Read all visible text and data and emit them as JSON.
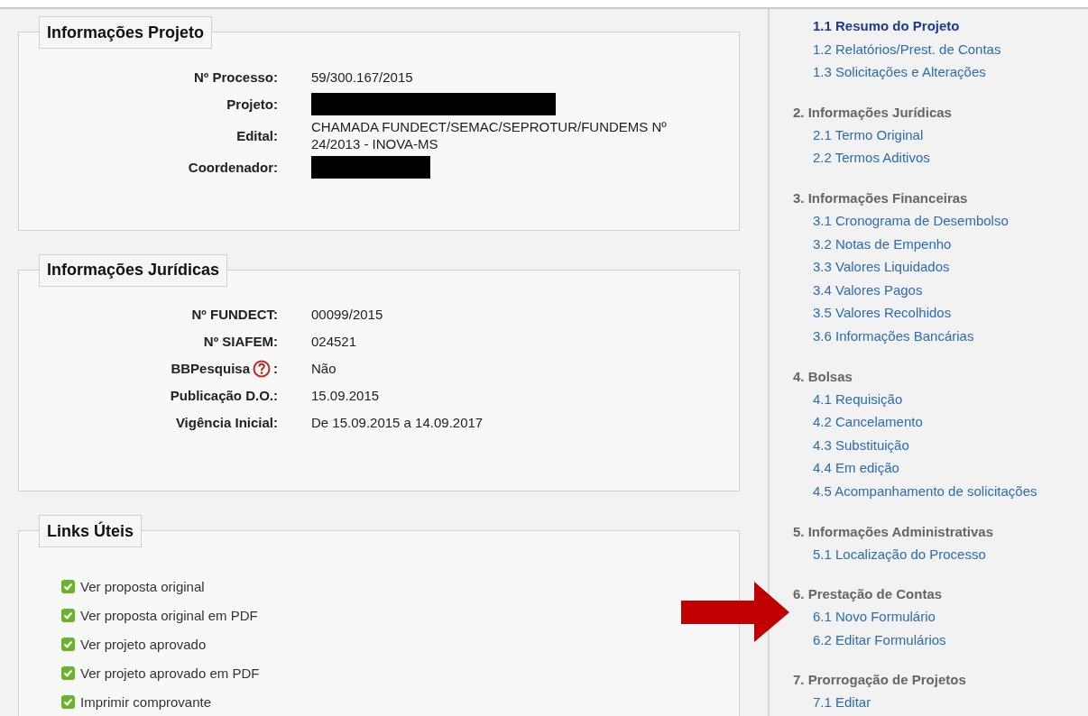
{
  "panels": [
    {
      "title": "Informações Projeto",
      "kind": "fields",
      "fields": [
        {
          "label": "Nº Processo:",
          "value": "59/300.167/2015",
          "kind": "text"
        },
        {
          "label": "Projeto:",
          "kind": "redacted"
        },
        {
          "label": "Edital:",
          "value": "CHAMADA FUNDECT/SEMAC/SEPROTUR/FUNDEMS Nº 24/2013 - INOVA-MS",
          "kind": "text"
        },
        {
          "label": "Coordenador:",
          "kind": "redacted"
        }
      ]
    },
    {
      "title": "Informações Jurídicas",
      "kind": "fields",
      "fields": [
        {
          "label": "Nº FUNDECT:",
          "value": "00099/2015",
          "kind": "text"
        },
        {
          "label": "Nº SIAFEM:",
          "value": "024521",
          "kind": "text"
        },
        {
          "label": "BBPesquisa",
          "help": true,
          "label_suffix": ":",
          "value": "Não",
          "kind": "text"
        },
        {
          "label": "Publicação D.O.:",
          "value": "15.09.2015",
          "kind": "text"
        },
        {
          "label": "Vigência Inicial:",
          "value": "De 15.09.2015 a 14.09.2017",
          "kind": "text"
        }
      ]
    },
    {
      "title": "Links Úteis",
      "kind": "links",
      "links": [
        {
          "label": "Ver proposta original",
          "checked": true
        },
        {
          "label": "Ver proposta original em PDF",
          "checked": true
        },
        {
          "label": "Ver projeto aprovado",
          "checked": true
        },
        {
          "label": "Ver projeto aprovado em PDF",
          "checked": true
        },
        {
          "label": "Imprimir comprovante",
          "checked": true
        }
      ]
    }
  ],
  "sidebar": {
    "sections": [
      {
        "items": [
          {
            "label": "1.1 Resumo do Projeto",
            "selected": true
          },
          {
            "label": "1.2 Relatórios/Prest. de Contas",
            "selected": false
          },
          {
            "label": "1.3 Solicitações e Alterações",
            "selected": false
          }
        ]
      },
      {
        "heading": "2. Informações Jurídicas",
        "items": [
          {
            "label": "2.1 Termo Original",
            "selected": false
          },
          {
            "label": "2.2 Termos Aditivos",
            "selected": false
          }
        ]
      },
      {
        "heading": "3. Informações Financeiras",
        "items": [
          {
            "label": "3.1 Cronograma de Desembolso",
            "selected": false
          },
          {
            "label": "3.2 Notas de Empenho",
            "selected": false
          },
          {
            "label": "3.3 Valores Liquidados",
            "selected": false
          },
          {
            "label": "3.4 Valores Pagos",
            "selected": false
          },
          {
            "label": "3.5 Valores Recolhidos",
            "selected": false
          },
          {
            "label": "3.6 Informações Bancárias",
            "selected": false
          }
        ]
      },
      {
        "heading": "4. Bolsas",
        "items": [
          {
            "label": "4.1 Requisição",
            "selected": false
          },
          {
            "label": "4.2 Cancelamento",
            "selected": false
          },
          {
            "label": "4.3 Substituição",
            "selected": false
          },
          {
            "label": "4.4 Em edição",
            "selected": false
          },
          {
            "label": "4.5 Acompanhamento de solicitações",
            "selected": false
          }
        ]
      },
      {
        "heading": "5. Informações Administrativas",
        "items": [
          {
            "label": "5.1 Localização do Processo",
            "selected": false
          }
        ]
      },
      {
        "heading": "6. Prestação de Contas",
        "items": [
          {
            "label": "6.1 Novo Formulário",
            "selected": false
          },
          {
            "label": "6.2 Editar Formulários",
            "selected": false
          }
        ]
      },
      {
        "heading": "7. Prorrogação de Projetos",
        "items": [
          {
            "label": "7.1 Editar",
            "selected": false
          }
        ]
      }
    ]
  },
  "annotation": {
    "kind": "arrow"
  }
}
